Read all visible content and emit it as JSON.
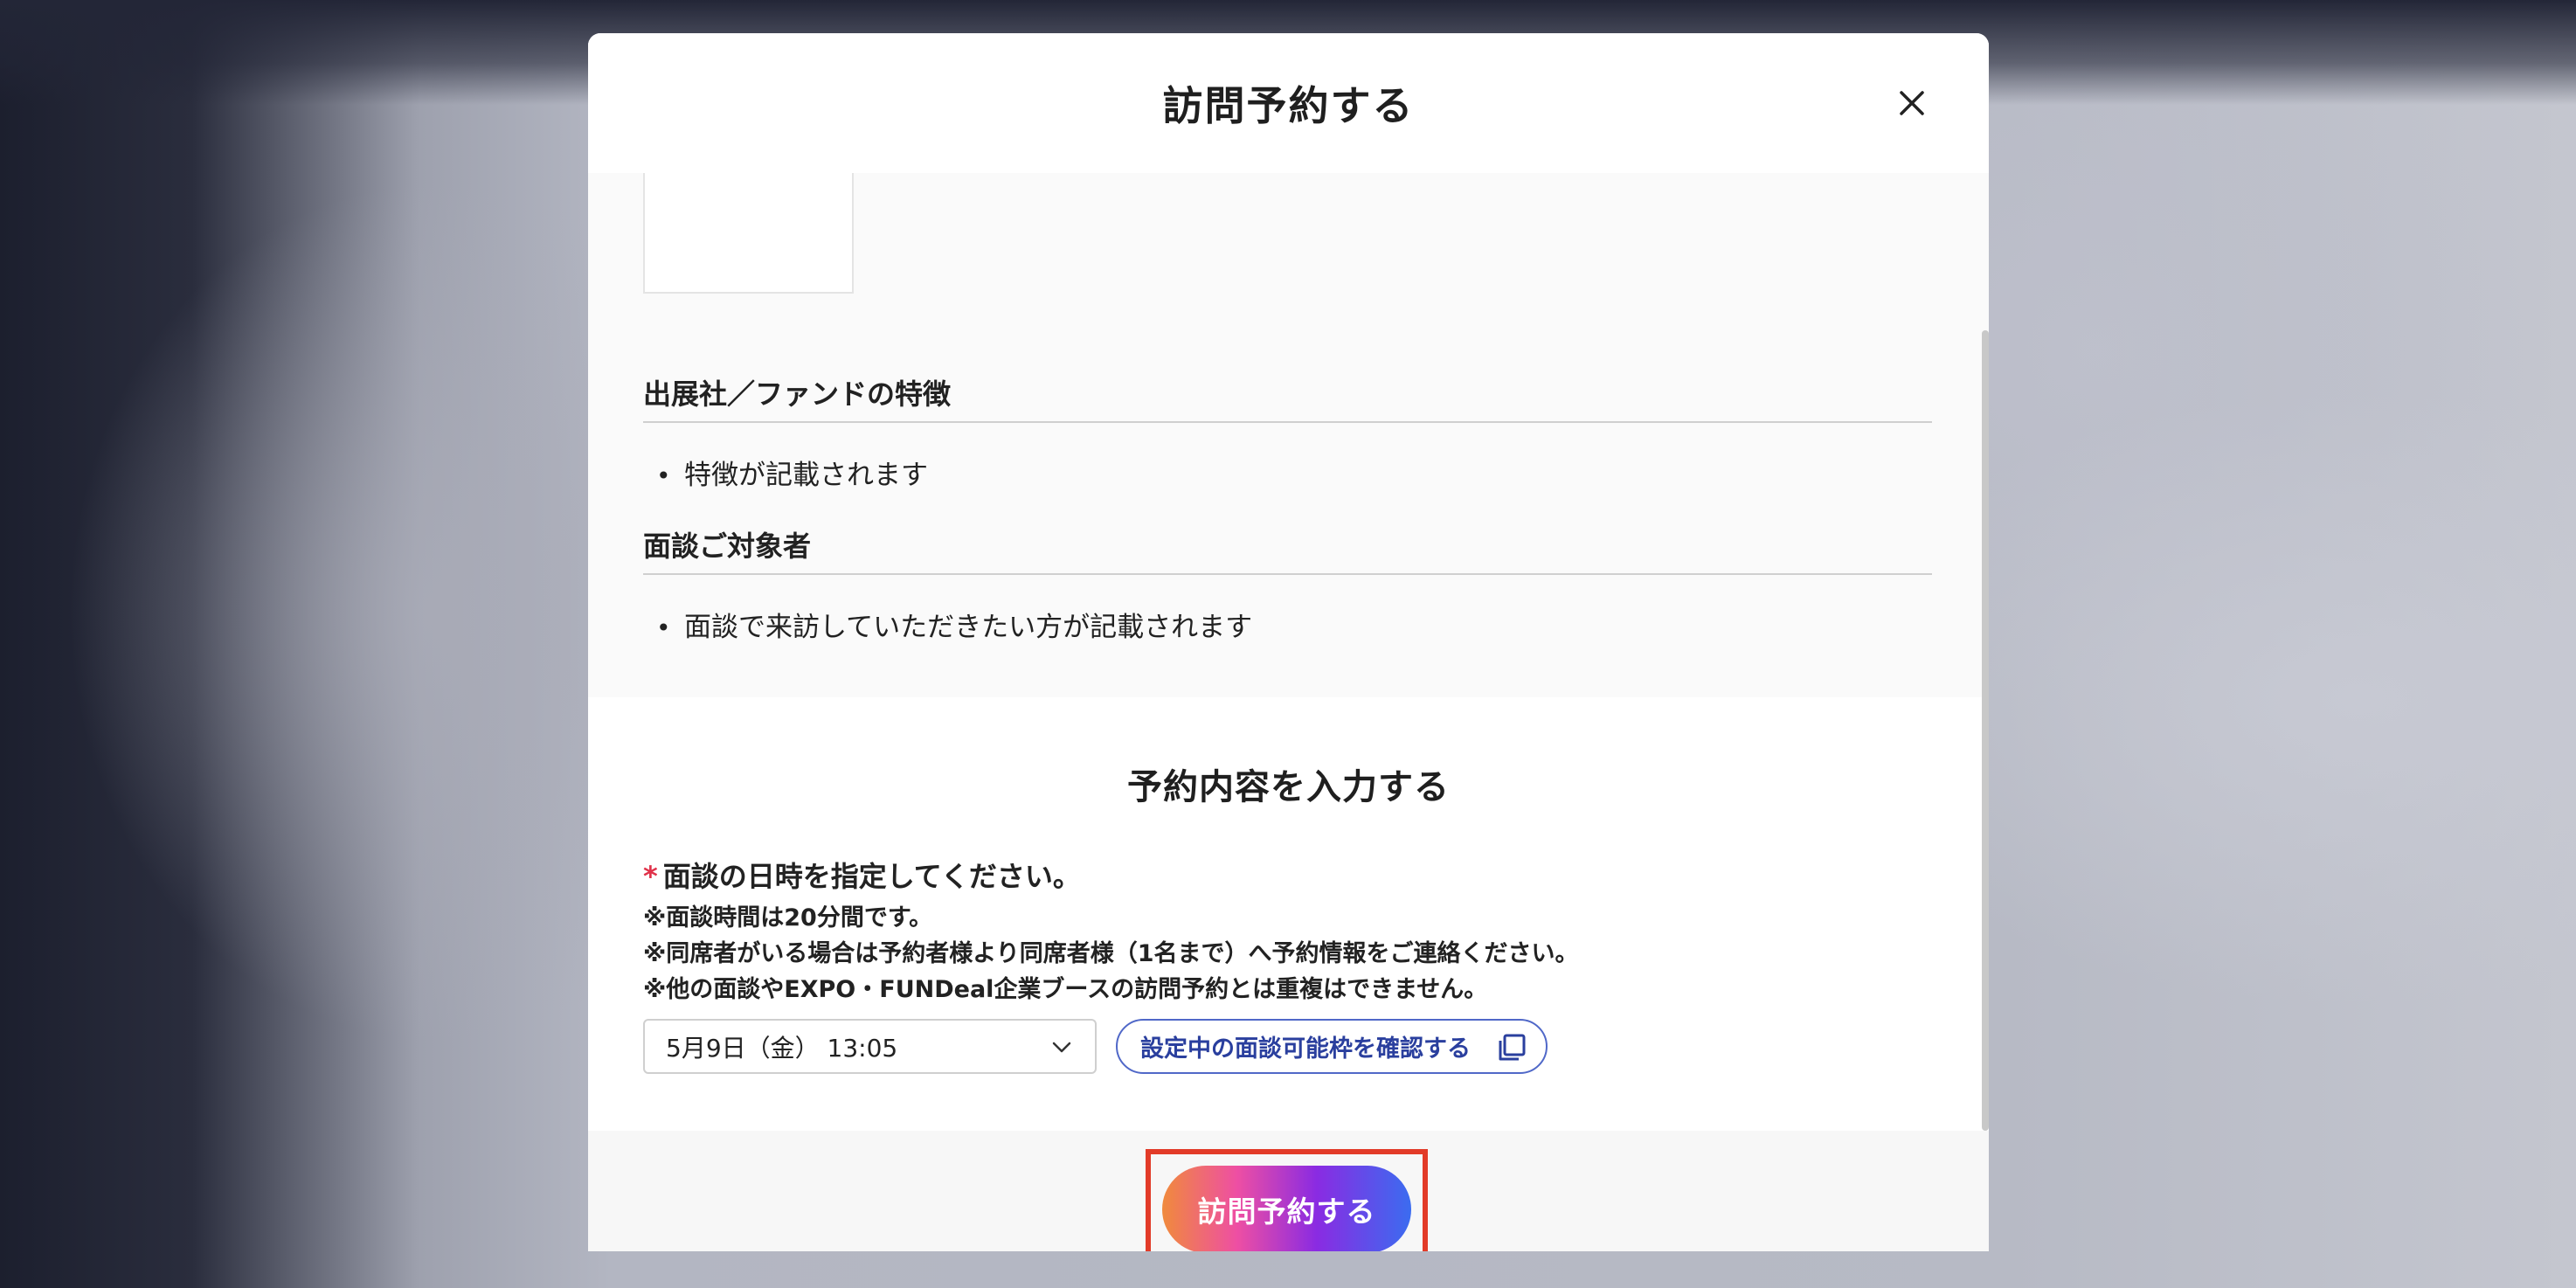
{
  "modal": {
    "title": "訪問予約する"
  },
  "info": {
    "features_heading": "出展社／ファンドの特徴",
    "features_item": "特徴が記載されます",
    "target_heading": "面談ご対象者",
    "target_item": "面談で来訪していただきたい方が記載されます"
  },
  "form": {
    "title": "予約内容を入力する",
    "required_mark": "*",
    "datetime_label": "面談の日時を指定してください。",
    "notes": [
      "※面談時間は20分間です。",
      "※同席者がいる場合は予約者様より同席者様（1名まで）へ予約情報をご連絡ください。",
      "※他の面談やEXPO・FUNDeal企業ブースの訪問予約とは重複はできません。"
    ],
    "datetime_value": "5月9日（金） 13:05",
    "confirm_slots_label": "設定中の面談可能枠を確認する"
  },
  "footer": {
    "submit_label": "訪問予約する"
  },
  "colors": {
    "required": "#e0324a",
    "link": "#2a3f9e",
    "highlight": "#e23b28"
  }
}
